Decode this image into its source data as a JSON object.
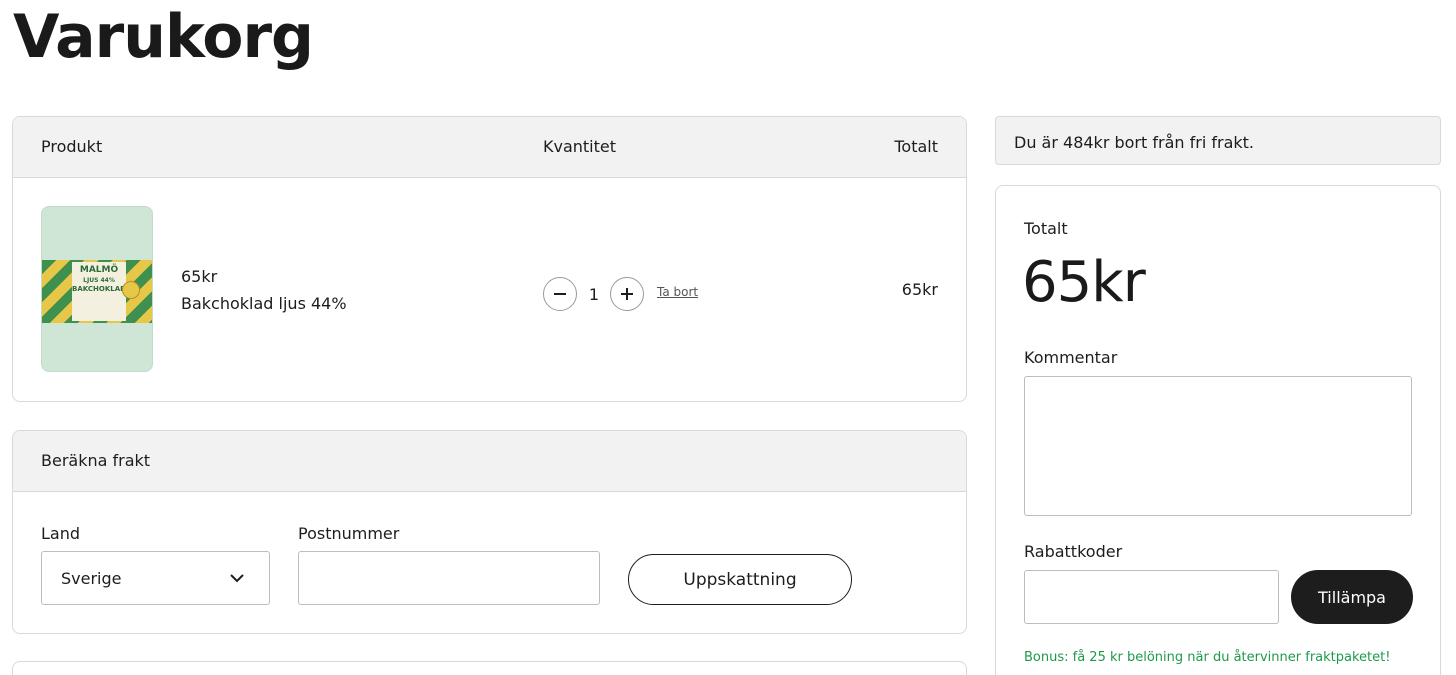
{
  "page": {
    "title": "Varukorg"
  },
  "cart": {
    "headers": {
      "product": "Produkt",
      "quantity": "Kvantitet",
      "total": "Totalt"
    },
    "item": {
      "image_alt": "Bakchoklad ljus 44%",
      "image_text": {
        "brand": "MALMÖ",
        "variant": "LJUS 44%",
        "type": "BAKCHOKLAD"
      },
      "price": "65kr",
      "name": "Bakchoklad ljus 44%",
      "quantity": "1",
      "remove_label": "Ta bort",
      "line_total": "65kr"
    },
    "icons": {
      "decrease": "minus-icon",
      "increase": "plus-icon"
    }
  },
  "shipping": {
    "title": "Beräkna frakt",
    "country_label": "Land",
    "country_value": "Sverige",
    "postcode_label": "Postnummer",
    "postcode_value": "",
    "estimate_button": "Uppskattning"
  },
  "summary": {
    "free_shipping_note": "Du är 484kr bort från fri frakt.",
    "total_label": "Totalt",
    "total_value": "65kr",
    "comment_label": "Kommentar",
    "comment_value": "",
    "discount_label": "Rabattkoder",
    "discount_value": "",
    "apply_button": "Tillämpa",
    "bonus_text": "Bonus: få 25 kr belöning när du återvinner fraktpaketet!"
  },
  "colors": {
    "accent": "#1d1d1d",
    "bonus_text": "#1f9a4c",
    "header_bg": "#f2f2f2"
  }
}
